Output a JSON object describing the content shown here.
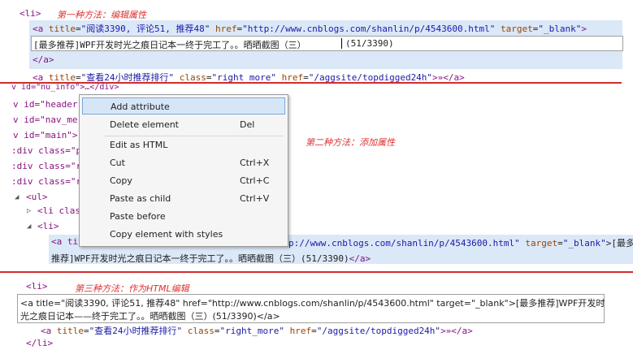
{
  "notes": {
    "method1": "第一种方法：编辑属性",
    "method2": "第二种方法：添加属性",
    "method3": "第三种方法：作为HTML编辑"
  },
  "section1": {
    "li_open": "<li>",
    "a_line": {
      "open": "<a ",
      "title_attr": "title",
      "title_val": "\"阅读3390, 评论51, 推荐48\"",
      "href_attr": "href",
      "href_val": "\"http://www.cnblogs.com/shanlin/p/4543600.html\"",
      "target_attr": "target",
      "target_val": "\"_blank\"",
      "close": ">"
    },
    "edit_text": "[最多推荐]WPF开发时光之痕日记本一终于完工了。。晒晒截图（三）",
    "edit_count": "(51/3390)",
    "a_close": "</a>",
    "a2": {
      "open": "<a ",
      "title_attr": "title",
      "title_val": "\"查看24小时推荐排行\"",
      "class_attr": "class",
      "class_val": "\"right_more\"",
      "href_attr": "href",
      "href_val": "\"/aggsite/topdigged24h\"",
      "rest": ">»</a>"
    }
  },
  "section2": {
    "partial_top": "v id=\"nu_info\">…</div>",
    "lines": [
      "v id=\"header",
      "v id=\"nav_me",
      "v id=\"main\">",
      ":div class=\"p",
      ":div class=\"r",
      ":div class=\"r"
    ],
    "ul": "<ul>",
    "li_class": "<li clas",
    "li": "<li>",
    "a_open": "<a tit",
    "a_href_tail": "p://www.cnblogs.com/shanlin/p/4543600.html\"",
    "a_target_attr": "target",
    "a_target_val": "\"_blank\"",
    "a_text_tail": ">[最多",
    "a_text_line2": "推荐]WPF开发时光之痕日记本一终于完工了。。晒晒截图（三）(51/3390)",
    "a_close": "</a>"
  },
  "context_menu": {
    "items": [
      {
        "label": "Add attribute",
        "shortcut": ""
      },
      {
        "label": "Delete element",
        "shortcut": "Del"
      },
      {
        "label": "Edit as HTML",
        "shortcut": ""
      },
      {
        "label": "Cut",
        "shortcut": "Ctrl+X"
      },
      {
        "label": "Copy",
        "shortcut": "Ctrl+C"
      },
      {
        "label": "Paste as child",
        "shortcut": "Ctrl+V"
      },
      {
        "label": "Paste before",
        "shortcut": ""
      },
      {
        "label": "Copy element with styles",
        "shortcut": ""
      }
    ]
  },
  "section3": {
    "li_open": "<li>",
    "html_line1": "<a title=\"阅读3390, 评论51, 推荐48\" href=\"http://www.cnblogs.com/shanlin/p/4543600.html\" target=\"_blank\">[最多推荐]WPF开发时",
    "html_line2": "光之痕日记本——终于完工了。。晒晒截图（三）(51/3390)</a>",
    "a2": {
      "open": "<a ",
      "title_attr": "title",
      "title_val": "\"查看24小时推荐排行\"",
      "class_attr": "class",
      "class_val": "\"right_more\"",
      "href_attr": "href",
      "href_val": "\"/aggsite/topdigged24h\"",
      "rest": ">»</a>"
    },
    "li_close": "</li>"
  },
  "colors": {
    "tag": "#881280",
    "attr": "#994500",
    "value": "#1a1aa6",
    "note": "#e03030",
    "separator": "#d42b2b",
    "selection": "#dbe8f8"
  }
}
